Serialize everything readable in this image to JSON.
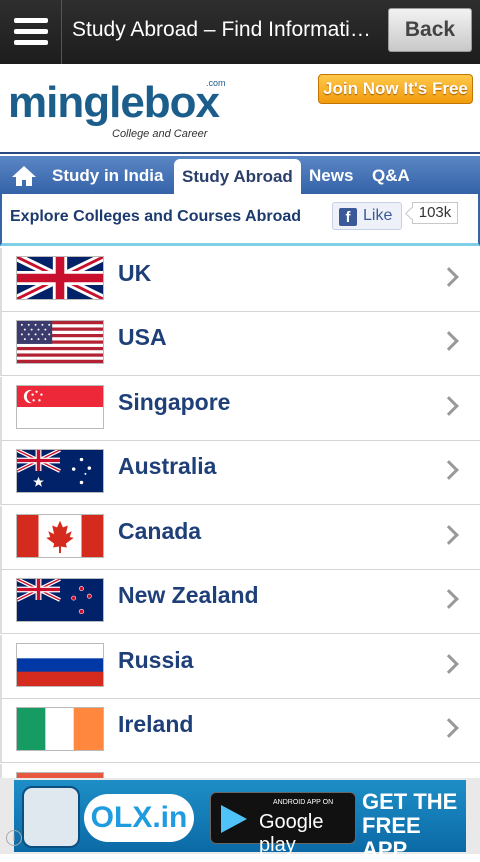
{
  "topbar": {
    "title": "Study Abroad – Find Informatio…",
    "back_label": "Back"
  },
  "header": {
    "logo_text": "minglebox",
    "logo_com": ".com",
    "logo_tagline": "College and Career",
    "join_label": "Join Now It's Free"
  },
  "nav": {
    "items": [
      "Study in India",
      "Study Abroad",
      "News",
      "Q&A"
    ],
    "active": "Study Abroad"
  },
  "subbar": {
    "title": "Explore Colleges and Courses Abroad",
    "like_label": "Like",
    "like_count": "103k"
  },
  "countries": [
    "UK",
    "USA",
    "Singapore",
    "Australia",
    "Canada",
    "New Zealand",
    "Russia",
    "Ireland"
  ],
  "ad": {
    "brand": "OLX.in",
    "store_small": "ANDROID APP ON",
    "store_big": "Google play",
    "cta": "GET THE FREE APP"
  },
  "colors": {
    "nav_blue": "#3563a8",
    "country_text": "#1e3f78",
    "join_orange": "#f29b0d"
  }
}
